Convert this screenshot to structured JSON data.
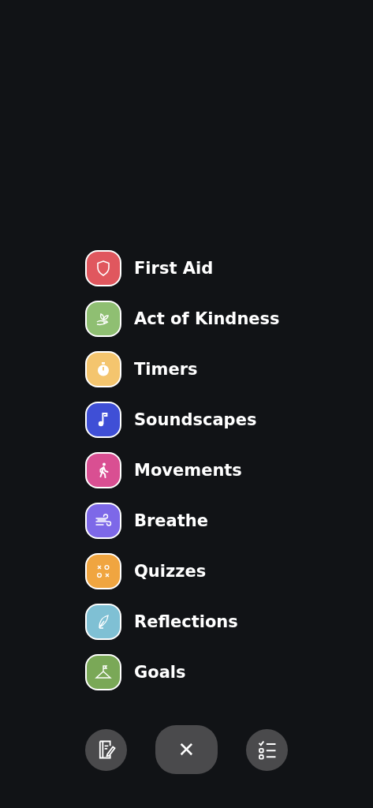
{
  "menu": {
    "items": [
      {
        "label": "First Aid",
        "kind": "shield",
        "color": "#e0575e"
      },
      {
        "label": "Act of Kindness",
        "kind": "hand",
        "color": "#8fbf72"
      },
      {
        "label": "Timers",
        "kind": "stopwatch",
        "color": "#f4c56e"
      },
      {
        "label": "Soundscapes",
        "kind": "note",
        "color": "#3f4fd6"
      },
      {
        "label": "Movements",
        "kind": "walker",
        "color": "#d94f92"
      },
      {
        "label": "Breathe",
        "kind": "wind",
        "color": "#7d68e8"
      },
      {
        "label": "Quizzes",
        "kind": "xo",
        "color": "#f0a540"
      },
      {
        "label": "Reflections",
        "kind": "feather",
        "color": "#7fc0d4"
      },
      {
        "label": "Goals",
        "kind": "flag",
        "color": "#7aa857"
      }
    ]
  },
  "actions": [
    {
      "kind": "journal"
    },
    {
      "kind": "close",
      "label": "✕"
    },
    {
      "kind": "checklist"
    }
  ]
}
